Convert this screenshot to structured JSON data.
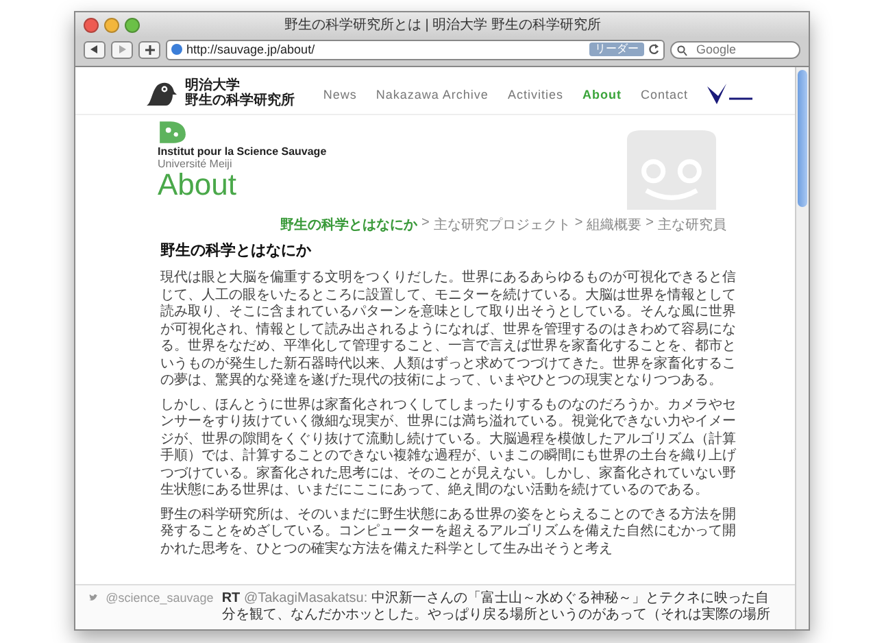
{
  "window": {
    "title": "野生の科学研究所とは | 明治大学 野生の科学研究所"
  },
  "toolbar": {
    "url": "http://sauvage.jp/about/",
    "reader_button": "リーダー",
    "search": {
      "placeholder": "Google"
    }
  },
  "site_header": {
    "logo_lines": [
      "明治大学",
      "野生の科学研究所"
    ],
    "nav": [
      {
        "label": "News",
        "selected": false
      },
      {
        "label": "Nakazawa Archive",
        "selected": false
      },
      {
        "label": "Activities",
        "selected": false
      },
      {
        "label": "About",
        "selected": true
      },
      {
        "label": "Contact",
        "selected": false
      }
    ]
  },
  "hero": {
    "institute": "Institut pour la Science Sauvage",
    "university": "Université Meiji",
    "heading": "About"
  },
  "breadcrumb": [
    {
      "label": "野生の科学とはなにか",
      "selected": true
    },
    {
      "label": "主な研究プロジェクト",
      "selected": false
    },
    {
      "label": "組織概要",
      "selected": false
    },
    {
      "label": "主な研究員",
      "selected": false
    }
  ],
  "breadcrumb_separator": ">",
  "article": {
    "title": "野生の科学とはなにか",
    "paragraphs": [
      "現代は眼と大脳を偏重する文明をつくりだした。世界にあるあらゆるものが可視化できると信じて、人工の眼をいたるところに設置して、モニターを続けている。大脳は世界を情報として読み取り、そこに含まれているパターンを意味として取り出そうとしている。そんな風に世界が可視化され、情報として読み出されるようになれば、世界を管理するのはきわめて容易になる。世界をなだめ、平準化して管理すること、一言で言えば世界を家畜化することを、都市というものが発生した新石器時代以来、人類はずっと求めてつづけてきた。世界を家畜化するこの夢は、驚異的な発達を遂げた現代の技術によって、いまやひとつの現実となりつつある。",
      "しかし、ほんとうに世界は家畜化されつくしてしまったりするものなのだろうか。カメラやセンサーをすり抜けていく微細な現実が、世界には満ち溢れている。視覚化できない力やイメージが、世界の隙間をくぐり抜けて流動し続けている。大脳過程を模倣したアルゴリズム（計算手順）では、計算することのできない複雑な過程が、いまこの瞬間にも世界の土台を織り上げつづけている。家畜化された思考には、そのことが見えない。しかし、家畜化されていない野生状態にある世界は、いまだにここにあって、絶え間のない活動を続けているのである。",
      "野生の科学研究所は、そのいまだに野生状態にある世界の姿をとらえることのできる方法を開発することをめざしている。コンピューターを超えるアルゴリズムを備えた自然にむかって開かれた思考を、ひとつの確実な方法を備えた科学として生み出そうと考え"
    ]
  },
  "twitter_bar": {
    "account": "@science_sauvage",
    "prefix": "RT",
    "mention": "@TakagiMasakatsu:",
    "text": "中沢新一さんの「富士山～水めぐる神秘～」とテクネに映った自分を観て、なんだかホッとした。やっぱり戻る場所というのがあって（それは実際の場所"
  }
}
